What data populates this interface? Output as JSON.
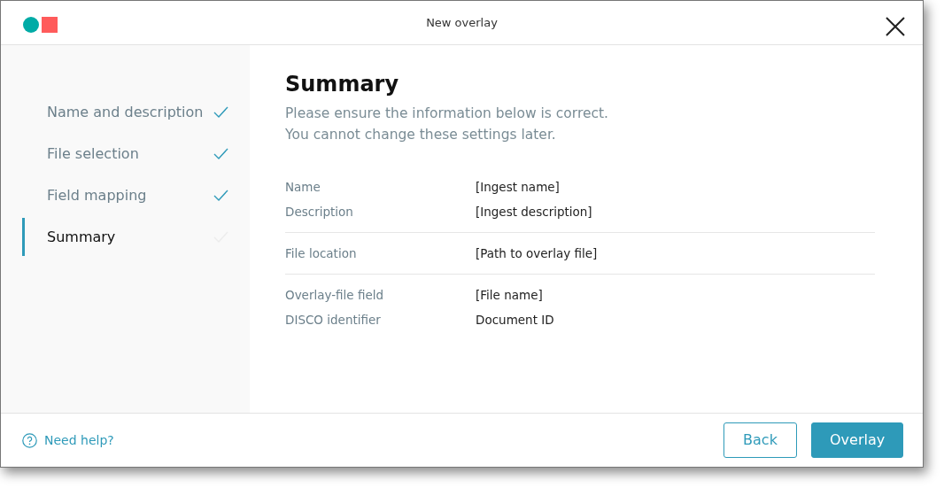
{
  "window": {
    "title": "New overlay"
  },
  "steps": [
    {
      "label": "Name and description",
      "completed": true,
      "selected": false
    },
    {
      "label": "File selection",
      "completed": true,
      "selected": false
    },
    {
      "label": "Field mapping",
      "completed": true,
      "selected": false
    },
    {
      "label": "Summary",
      "completed": false,
      "selected": true
    }
  ],
  "summary": {
    "heading": "Summary",
    "intro": [
      "Please ensure the information below is correct.",
      "You cannot change these settings later."
    ],
    "groups": [
      [
        {
          "label": "Name",
          "value": "[Ingest name]"
        },
        {
          "label": "Description",
          "value": "[Ingest description]"
        }
      ],
      [
        {
          "label": "File location",
          "value": "[Path to overlay file]"
        }
      ],
      [
        {
          "label": "Overlay-file field",
          "value": "[File name]"
        },
        {
          "label": "DISCO identifier",
          "value": "Document ID"
        }
      ]
    ]
  },
  "footer": {
    "help": "Need help?",
    "buttons": [
      {
        "label": "Back",
        "kind": "secondary"
      },
      {
        "label": "Overlay",
        "kind": "primary"
      }
    ]
  }
}
